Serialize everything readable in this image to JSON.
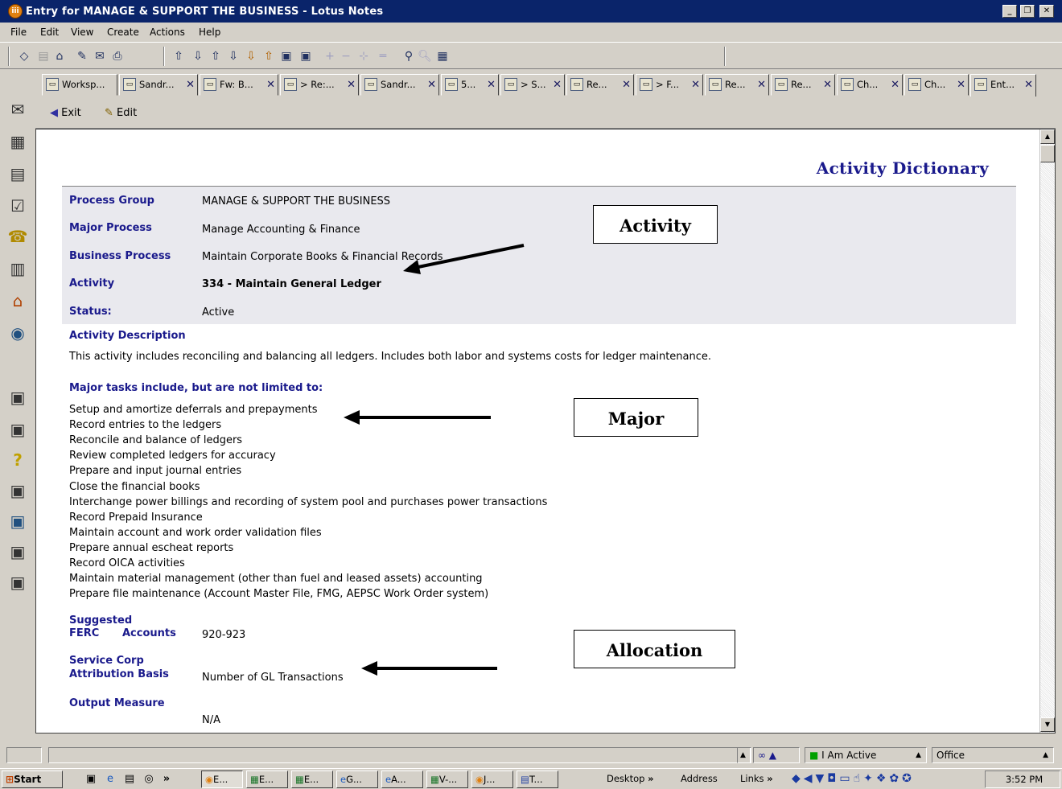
{
  "window": {
    "title": "Entry for MANAGE & SUPPORT THE BUSINESS - Lotus Notes",
    "app_icon_text": "iii"
  },
  "menu": [
    "File",
    "Edit",
    "View",
    "Create",
    "Actions",
    "Help"
  ],
  "tabs": [
    {
      "label": "Worksp..."
    },
    {
      "label": "Sandr..."
    },
    {
      "label": "Fw: B..."
    },
    {
      "label": "> Re:..."
    },
    {
      "label": "Sandr..."
    },
    {
      "label": "5..."
    },
    {
      "label": "> S..."
    },
    {
      "label": "Re..."
    },
    {
      "label": "> F..."
    },
    {
      "label": "Re..."
    },
    {
      "label": "Re..."
    },
    {
      "label": "Ch..."
    },
    {
      "label": "Ch..."
    },
    {
      "label": "Ent..."
    }
  ],
  "actions": {
    "exit": "Exit",
    "edit": "Edit"
  },
  "document": {
    "title": "Activity Dictionary",
    "fields": [
      {
        "label": "Process Group",
        "value": "MANAGE & SUPPORT THE BUSINESS"
      },
      {
        "label": "Major Process",
        "value": "Manage Accounting & Finance"
      },
      {
        "label": "Business Process",
        "value": "Maintain Corporate Books & Financial Records"
      },
      {
        "label": "Activity",
        "value": "334 - Maintain General Ledger"
      },
      {
        "label": "Status:",
        "value": "Active"
      }
    ],
    "description_label": "Activity Description",
    "description": "This activity includes reconciling and balancing all ledgers.  Includes both labor and systems costs for ledger maintenance.",
    "tasks_label": "Major tasks include, but are not limited to:",
    "tasks": [
      "Setup and amortize deferrals and prepayments",
      "Record entries to the ledgers",
      "Reconcile and balance of ledgers",
      "Review completed ledgers for accuracy",
      "Prepare and input journal entries",
      "Close the financial books",
      "Interchange power billings and recording of system pool and purchases power transactions",
      "Record Prepaid Insurance",
      "Maintain account and work order validation files",
      "Prepare annual escheat reports",
      "Record OICA activities",
      "Maintain material management (other than fuel and leased assets) accounting",
      "Prepare file maintenance (Account Master File, FMG, AEPSC Work Order system)"
    ],
    "ferc_label_1": "Suggested",
    "ferc_label_2a": "FERC",
    "ferc_label_2b": "Accounts",
    "ferc_value": "920-923",
    "svc_label_1": "Service Corp",
    "svc_label_2": "Attribution Basis",
    "svc_value": "Number of GL Transactions",
    "output_label": "Output Measure",
    "output_value": "N/A"
  },
  "callouts": {
    "activity": "Activity",
    "major": "Major",
    "allocation": "Allocation"
  },
  "statusbar": {
    "presence": "I Am Active",
    "location": "Office"
  },
  "taskbar": {
    "start": "Start",
    "buttons": [
      "E...",
      "E...",
      "E...",
      "G...",
      "A...",
      "V-...",
      "J...",
      "T..."
    ],
    "desktop": "Desktop",
    "address": "Address",
    "links": "Links",
    "clock": "3:52 PM"
  }
}
